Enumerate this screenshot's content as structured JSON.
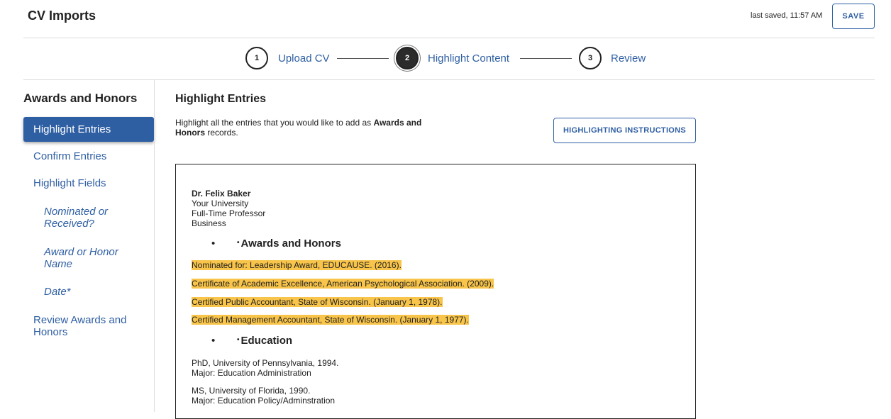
{
  "app": {
    "title": "CV Imports",
    "last_saved": "last saved, 11:57 AM",
    "save_label": "SAVE"
  },
  "stepper": {
    "steps": [
      {
        "number": "1",
        "label": "Upload CV",
        "state": "default"
      },
      {
        "number": "2",
        "label": "Highlight Content",
        "state": "active"
      },
      {
        "number": "3",
        "label": "Review",
        "state": "default"
      }
    ]
  },
  "sidebar": {
    "title": "Awards and Honors",
    "items": [
      {
        "label": "Highlight Entries",
        "active": true
      },
      {
        "label": "Confirm Entries"
      },
      {
        "label": "Highlight Fields"
      },
      {
        "label": "Nominated or Received?",
        "sub": true
      },
      {
        "label": "Award or Honor Name",
        "sub": true
      },
      {
        "label": "Date*",
        "sub": true
      },
      {
        "label": "Review Awards and Honors"
      }
    ]
  },
  "main": {
    "title": "Highlight Entries",
    "desc_prefix": "Highlight all the entries that you would like to add as ",
    "desc_bold": "Awards and Honors",
    "desc_suffix": " records.",
    "instructions_label": "HIGHLIGHTING INSTRUCTIONS"
  },
  "document": {
    "header": {
      "name": "Dr. Felix Baker",
      "university": "Your University",
      "position": "Full-Time Professor",
      "department": "Business"
    },
    "sections": [
      {
        "heading": "Awards and Honors",
        "entries": [
          "Nominated for: Leadership Award, EDUCAUSE. (2016).",
          "Certificate of Academic Excellence, American Psychological Association. (2009).",
          "Certified Public Accountant, State of Wisconsin. (January 1, 1978).",
          "Certified Management Accountant, State of Wisconsin. (January 1, 1977)."
        ]
      },
      {
        "heading": "Education",
        "entries": [
          {
            "degree": "PhD, University of Pennsylvania, 1994.",
            "major": "Major: Education Administration"
          },
          {
            "degree": "MS, University of Florida, 1990.",
            "major": "Major: Education Policy/Adminstration"
          }
        ]
      }
    ]
  },
  "colors": {
    "accent": "#2f5fa3",
    "highlight": "#f8c44a",
    "active_step": "#2b2b2b"
  }
}
